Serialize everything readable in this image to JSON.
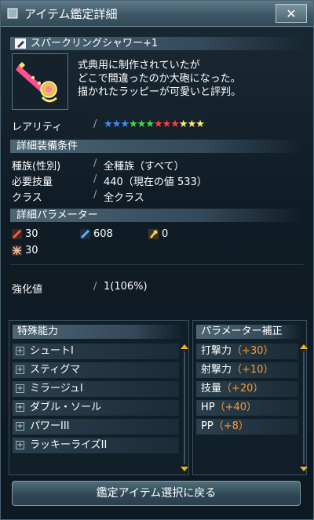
{
  "window": {
    "title": "アイテム鑑定詳細",
    "close_icon": "close-x-icon"
  },
  "item": {
    "name": "スパークリングシャワー+1",
    "description": [
      "式典用に制作されていたが",
      "どこで間違ったのか大砲になった。",
      "描かれたラッピーが可愛いと評判。"
    ]
  },
  "rarity": {
    "label": "レアリティ",
    "stars": [
      {
        "color": "#3d8cff"
      },
      {
        "color": "#3d8cff"
      },
      {
        "color": "#3d8cff"
      },
      {
        "color": "#42d94a"
      },
      {
        "color": "#42d94a"
      },
      {
        "color": "#42d94a"
      },
      {
        "color": "#ff3b3b"
      },
      {
        "color": "#ff3b3b"
      },
      {
        "color": "#ff3b3b"
      },
      {
        "color": "#fff06a"
      },
      {
        "color": "#fff06a"
      },
      {
        "color": "#fff06a"
      }
    ]
  },
  "requirements": {
    "heading": "詳細装備条件",
    "rows": [
      {
        "label": "種族(性別)",
        "value": "全種族（すべて）"
      },
      {
        "label": "必要技量",
        "value": "440（現在の値 533）"
      },
      {
        "label": "クラス",
        "value": "全クラス"
      }
    ]
  },
  "parameters": {
    "heading": "詳細パラメーター",
    "stats": [
      {
        "icon": "striking-attack-icon",
        "value": "30"
      },
      {
        "icon": "ranged-attack-icon",
        "value": "608"
      },
      {
        "icon": "technique-attack-icon",
        "value": "0"
      },
      {
        "icon": "defense-icon",
        "value": "30"
      }
    ]
  },
  "enhancement": {
    "label": "強化値",
    "value": "1(106%)"
  },
  "special_abilities": {
    "heading": "特殊能力",
    "items": [
      "シュートI",
      "スティグマ",
      "ミラージュI",
      "ダブル・ソール",
      "パワーIII",
      "ラッキーライズII"
    ]
  },
  "param_bonus": {
    "heading": "パラメーター補正",
    "items": [
      {
        "label": "打撃力",
        "value": "（+30）"
      },
      {
        "label": "射撃力",
        "value": "（+10）"
      },
      {
        "label": "技量",
        "value": "（+20）"
      },
      {
        "label": "HP",
        "value": "（+40）"
      },
      {
        "label": "PP",
        "value": "（+8）"
      }
    ]
  },
  "footer": {
    "back_button": "鑑定アイテム選択に戻る"
  },
  "colors": {
    "accent_orange": "#ff9a2e",
    "scroll_arrow": "#f3b21b"
  }
}
